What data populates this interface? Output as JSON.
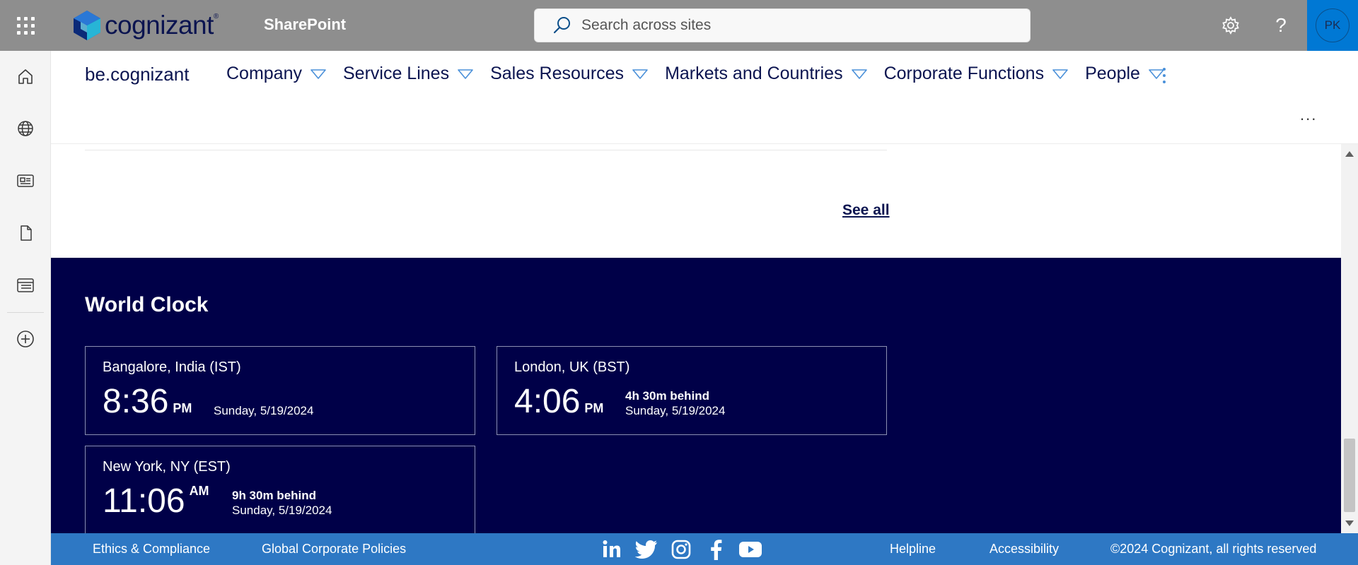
{
  "suite": {
    "brand": "cognizant",
    "app_name": "SharePoint",
    "search_placeholder": "Search across sites",
    "avatar_initials": "PK",
    "settings_icon": "gear-icon",
    "help_icon": "question-mark-icon",
    "help_glyph": "?"
  },
  "rail": {
    "items": [
      {
        "icon": "home-icon"
      },
      {
        "icon": "globe-icon"
      },
      {
        "icon": "news-icon"
      },
      {
        "icon": "document-icon"
      },
      {
        "icon": "list-icon"
      },
      {
        "icon": "add-circle-icon"
      }
    ]
  },
  "site": {
    "title": "be.cognizant",
    "nav": [
      {
        "label": "Company"
      },
      {
        "label": "Service Lines"
      },
      {
        "label": "Sales Resources"
      },
      {
        "label": "Markets and Countries"
      },
      {
        "label": "Corporate Functions"
      },
      {
        "label": "People"
      }
    ],
    "more_glyph": "...",
    "nav_accent": "#4a90d9"
  },
  "news": {
    "see_all": "See all"
  },
  "world_clock": {
    "title": "World Clock",
    "band_color": "#000048",
    "clocks": [
      {
        "city": "Bangalore, India (IST)",
        "time": "8:36",
        "ampm": "PM",
        "offset": "",
        "date": "Sunday, 5/19/2024"
      },
      {
        "city": "London, UK (BST)",
        "time": "4:06",
        "ampm": "PM",
        "offset": "4h 30m behind",
        "date": "Sunday, 5/19/2024"
      },
      {
        "city": "New York, NY (EST)",
        "time": "11:06",
        "ampm": "AM",
        "offset": "9h 30m behind",
        "date": "Sunday, 5/19/2024"
      }
    ]
  },
  "footer": {
    "color": "#2e78c4",
    "links_left": [
      "Ethics & Compliance",
      "Global Corporate Policies"
    ],
    "social": [
      "linkedin-icon",
      "twitter-icon",
      "instagram-icon",
      "facebook-icon",
      "youtube-icon"
    ],
    "links_right": [
      "Helpline",
      "Accessibility"
    ],
    "copyright": "©2024 Cognizant, all rights reserved"
  }
}
